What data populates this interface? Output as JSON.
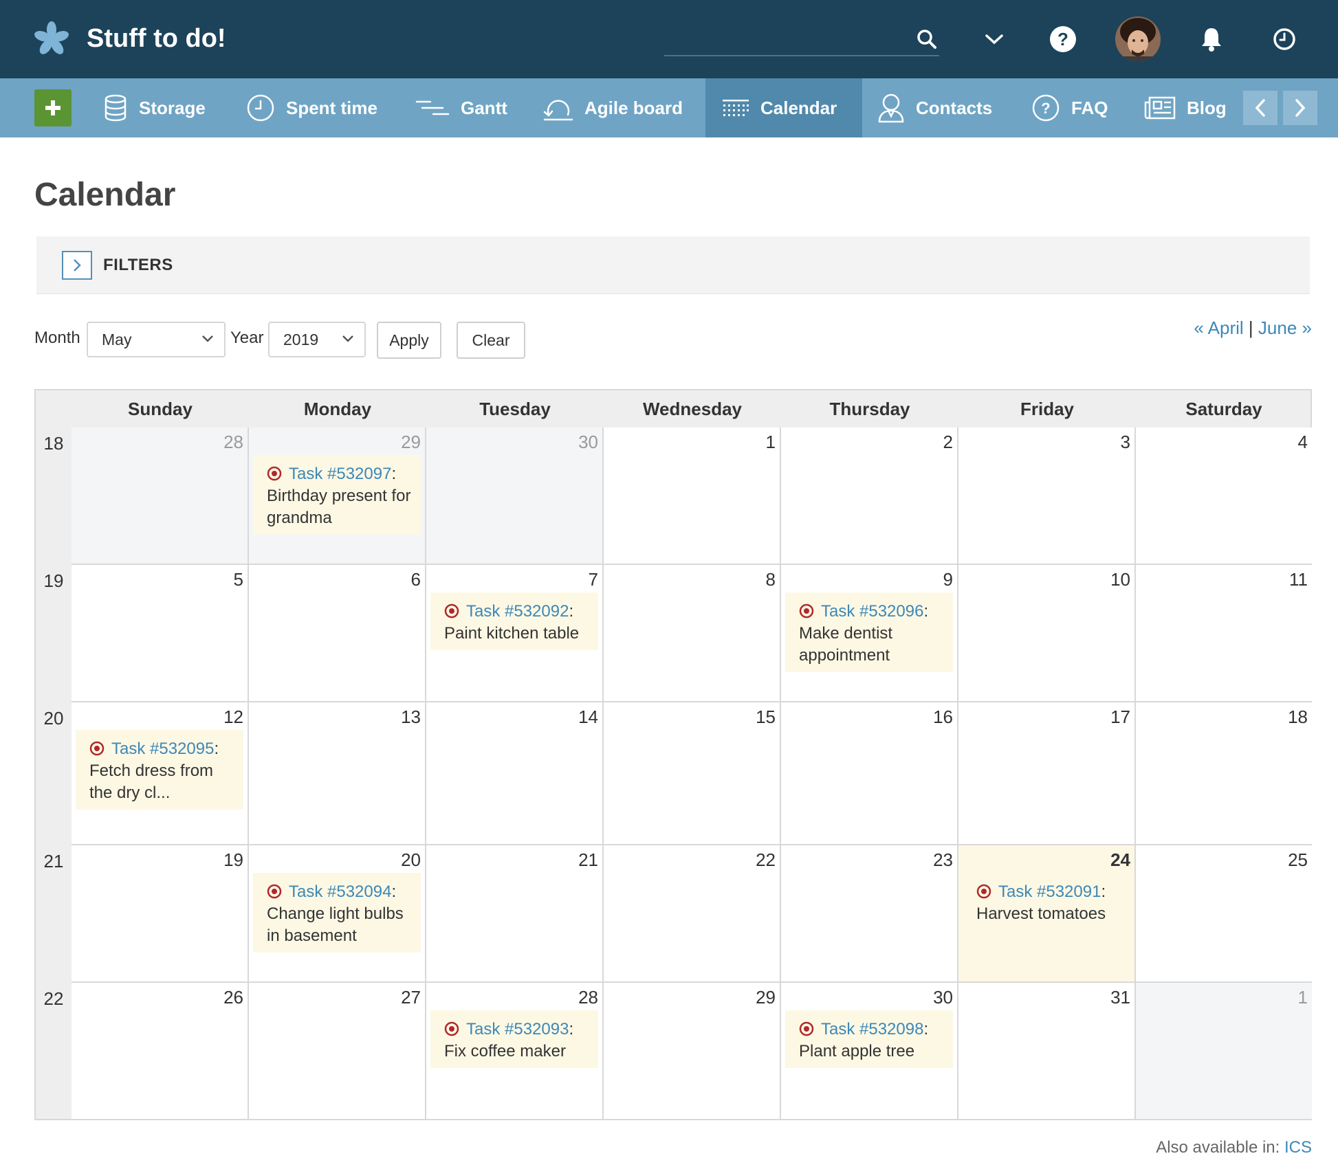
{
  "header": {
    "title": "Stuff to do!",
    "icons": [
      "asterisk-logo-icon",
      "search-icon",
      "chevron-down-icon",
      "help-icon",
      "avatar",
      "bell-icon",
      "clock-icon"
    ]
  },
  "nav": {
    "add_icon": "plus-icon",
    "items": [
      {
        "label": "Storage",
        "icon": "database-icon"
      },
      {
        "label": "Spent time",
        "icon": "clock-icon"
      },
      {
        "label": "Gantt",
        "icon": "gantt-icon"
      },
      {
        "label": "Agile board",
        "icon": "agile-icon"
      },
      {
        "label": "Calendar",
        "icon": "calendar-icon",
        "active": true
      },
      {
        "label": "Contacts",
        "icon": "contact-icon"
      },
      {
        "label": "FAQ",
        "icon": "question-icon"
      },
      {
        "label": "Blog",
        "icon": "news-icon"
      }
    ]
  },
  "page": {
    "title": "Calendar",
    "filters_label": "FILTERS"
  },
  "controls": {
    "month_label": "Month",
    "month_value": "May",
    "year_label": "Year",
    "year_value": "2019",
    "apply": "Apply",
    "clear": "Clear",
    "prev": "« April",
    "separator": "|",
    "next": "June »"
  },
  "calendar": {
    "days": [
      "Sunday",
      "Monday",
      "Tuesday",
      "Wednesday",
      "Thursday",
      "Friday",
      "Saturday"
    ],
    "weeks": [
      {
        "num": "18",
        "days": [
          "28",
          "29",
          "30",
          "1",
          "2",
          "3",
          "4"
        ]
      },
      {
        "num": "19",
        "days": [
          "5",
          "6",
          "7",
          "8",
          "9",
          "10",
          "11"
        ]
      },
      {
        "num": "20",
        "days": [
          "12",
          "13",
          "14",
          "15",
          "16",
          "17",
          "18"
        ]
      },
      {
        "num": "21",
        "days": [
          "19",
          "20",
          "21",
          "22",
          "23",
          "24",
          "25"
        ]
      },
      {
        "num": "22",
        "days": [
          "26",
          "27",
          "28",
          "29",
          "30",
          "31",
          "1"
        ]
      }
    ],
    "tasks": [
      {
        "id": "Task #532097",
        "title": "Birthday present for grandma"
      },
      {
        "id": "Task #532092",
        "title": "Paint kitchen table"
      },
      {
        "id": "Task #532096",
        "title": "Make dentist appointment"
      },
      {
        "id": "Task #532095",
        "title": "Fetch dress from the dry cl..."
      },
      {
        "id": "Task #532094",
        "title": "Change light bulbs in basement"
      },
      {
        "id": "Task #532091",
        "title": "Harvest tomatoes"
      },
      {
        "id": "Task #532093",
        "title": "Fix coffee maker"
      },
      {
        "id": "Task #532098",
        "title": "Plant apple tree"
      }
    ]
  },
  "footer": {
    "also_label": "Also available in:",
    "ics": "ICS"
  },
  "colors": {
    "header_bg": "#1c435a",
    "nav_bg": "#6fa4c4",
    "nav_active": "#5089ab",
    "add_button": "#5b9433",
    "link": "#3d88b7",
    "task_bg": "#fdf8e4",
    "target_red": "#b0282b"
  }
}
